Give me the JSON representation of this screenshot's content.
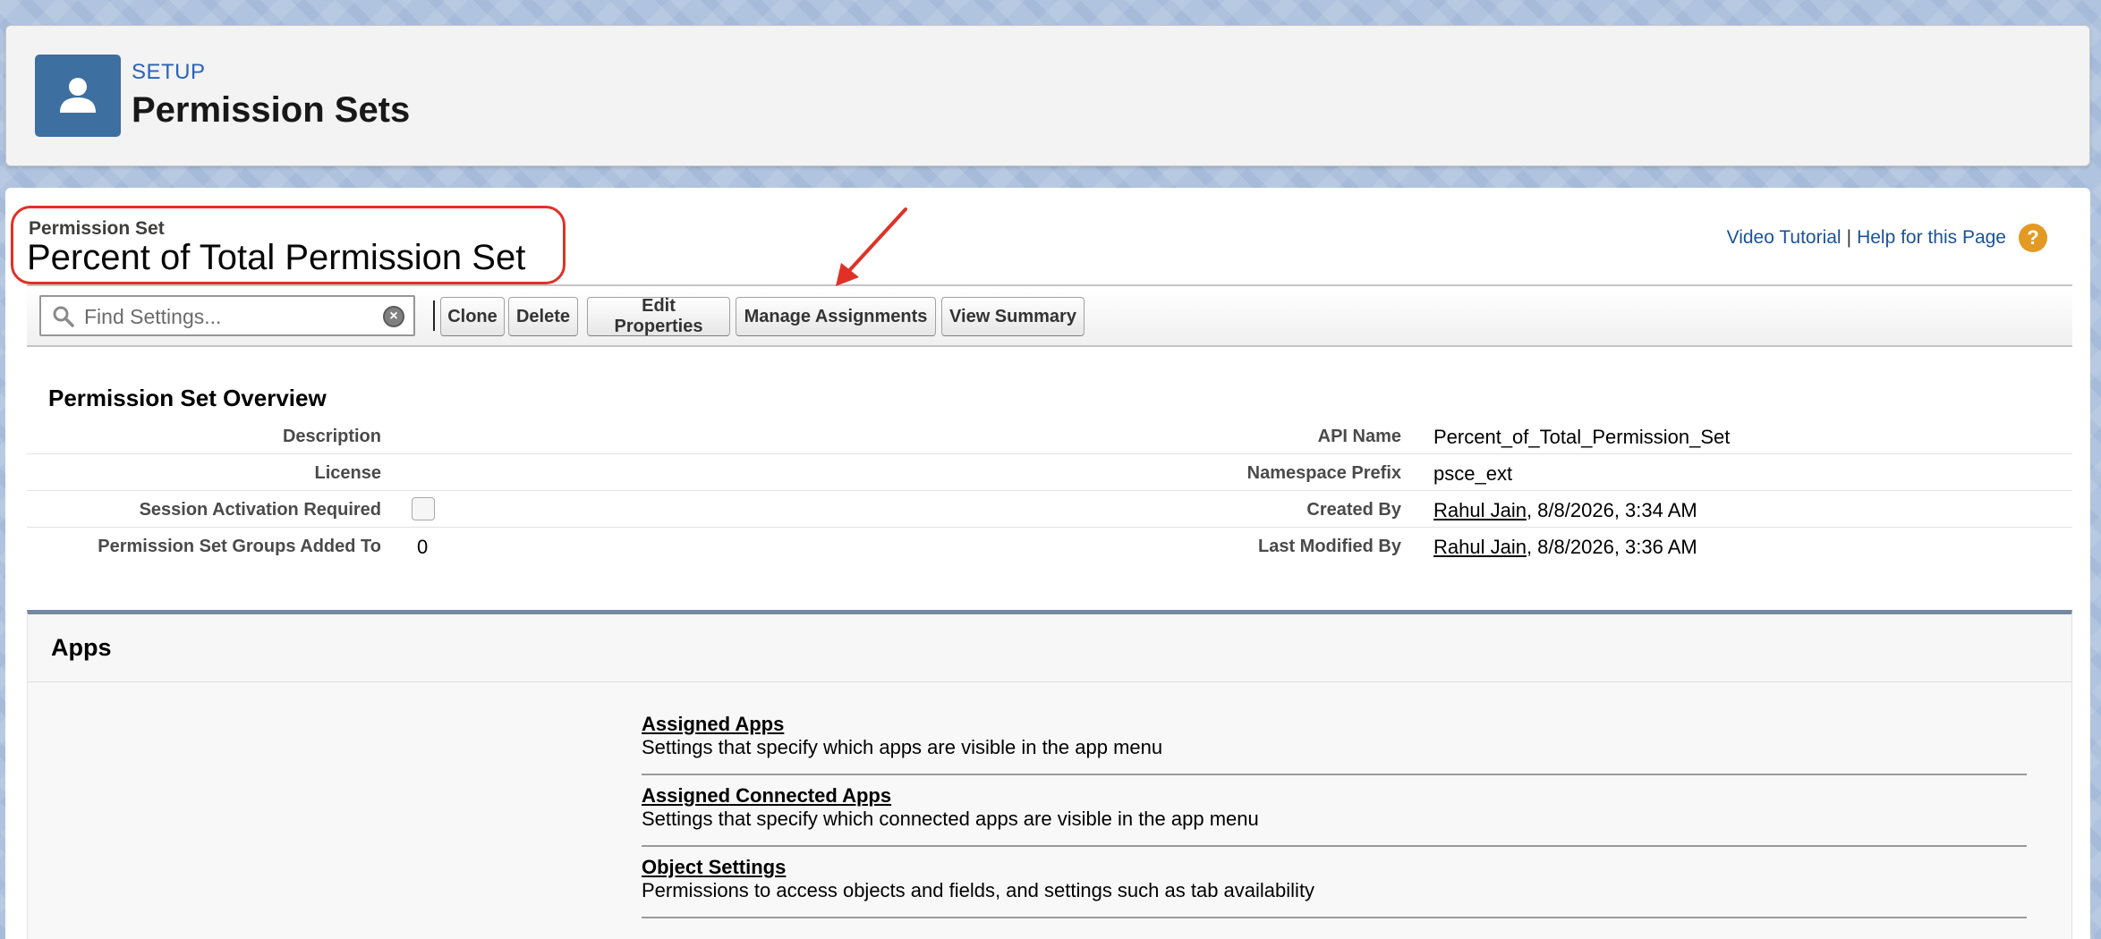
{
  "header": {
    "section": "SETUP",
    "title": "Permission Sets",
    "icon": "user-icon"
  },
  "permission_set": {
    "type_label": "Permission Set",
    "name": "Percent of Total Permission Set"
  },
  "help": {
    "video_tutorial": "Video Tutorial",
    "separator": "|",
    "help_page": "Help for this Page",
    "help_icon_glyph": "?"
  },
  "toolbar": {
    "search_placeholder": "Find Settings...",
    "clone": "Clone",
    "delete": "Delete",
    "edit_properties": "Edit Properties",
    "manage_assignments": "Manage Assignments",
    "view_summary": "View Summary"
  },
  "overview": {
    "title": "Permission Set Overview",
    "description_label": "Description",
    "description_value": "",
    "license_label": "License",
    "license_value": "",
    "session_label": "Session Activation Required",
    "session_checked": false,
    "groups_label": "Permission Set Groups Added To",
    "groups_value": "0",
    "api_name_label": "API Name",
    "api_name_value": "Percent_of_Total_Permission_Set",
    "namespace_label": "Namespace Prefix",
    "namespace_value": "psce_ext",
    "created_label": "Created By",
    "created_user": "Rahul Jain",
    "created_date": ", 8/8/2026, 3:34 AM",
    "modified_label": "Last Modified By",
    "modified_user": "Rahul Jain",
    "modified_date": ", 8/8/2026, 3:36 AM"
  },
  "apps": {
    "title": "Apps",
    "items": [
      {
        "label": "Assigned Apps",
        "description": "Settings that specify which apps are visible in the app menu"
      },
      {
        "label": "Assigned Connected Apps",
        "description": "Settings that specify which connected apps are visible in the app menu"
      },
      {
        "label": "Object Settings",
        "description": "Permissions to access objects and fields, and settings such as tab availability"
      }
    ]
  },
  "colors": {
    "highlight": "#e03127",
    "link": "#1b5297",
    "header_icon_bg": "#3d6fa0"
  }
}
